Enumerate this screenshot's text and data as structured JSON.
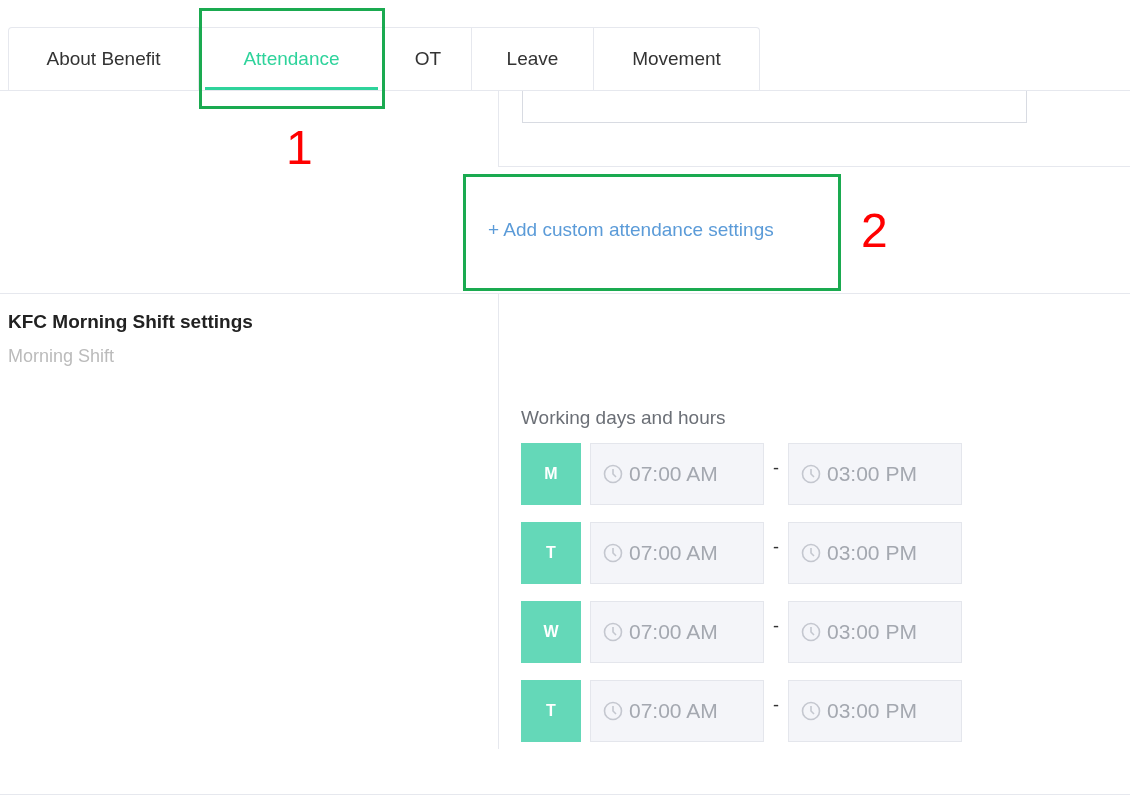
{
  "tabs": [
    {
      "label": "About Benefit",
      "selected": false
    },
    {
      "label": "Attendance",
      "selected": true
    },
    {
      "label": "OT",
      "selected": false
    },
    {
      "label": "Leave",
      "selected": false
    },
    {
      "label": "Movement",
      "selected": false
    }
  ],
  "add_link": "+ Add custom attendance settings",
  "shift": {
    "title": "KFC Morning Shift settings",
    "subtitle": "Morning Shift"
  },
  "working_days": {
    "label": "Working days and hours",
    "rows": [
      {
        "day": "M",
        "active": true,
        "start": "07:00 AM",
        "separator": "-",
        "end": "03:00 PM",
        "disabled": true
      },
      {
        "day": "T",
        "active": true,
        "start": "07:00 AM",
        "separator": "-",
        "end": "03:00 PM",
        "disabled": true
      },
      {
        "day": "W",
        "active": true,
        "start": "07:00 AM",
        "separator": "-",
        "end": "03:00 PM",
        "disabled": true
      },
      {
        "day": "T",
        "active": true,
        "start": "07:00 AM",
        "separator": "-",
        "end": "03:00 PM",
        "disabled": true
      }
    ]
  },
  "annotations": [
    {
      "number": "1"
    },
    {
      "number": "2"
    }
  ]
}
